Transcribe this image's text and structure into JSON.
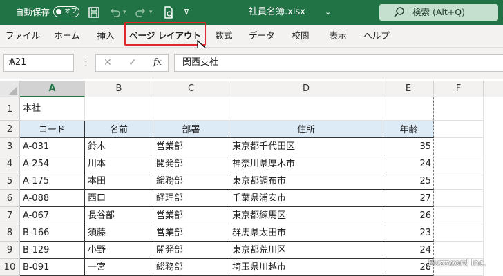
{
  "titlebar": {
    "autosave_label": "自動保存",
    "autosave_state": "オフ",
    "doc_title": "社員名簿.xlsx",
    "title_chevron": "⌄",
    "search_text": "検索 (Alt+Q)",
    "color": "#217346"
  },
  "ribbon": {
    "tabs": [
      "ファイル",
      "ホーム",
      "挿入",
      "ページ レイアウト",
      "数式",
      "データ",
      "校閲",
      "表示",
      "ヘルプ"
    ],
    "active_tab": "ページ レイアウト",
    "highlight_color": "#e0262b"
  },
  "formula_bar": {
    "name_box": "A21",
    "dots": "⋮",
    "cancel": "✕",
    "enter": "✓",
    "fx": "fx",
    "content": "関西支社"
  },
  "grid": {
    "columns": [
      "A",
      "B",
      "C",
      "D",
      "E",
      "F"
    ],
    "selected_column": "A",
    "rows": [
      "1",
      "2",
      "3",
      "4",
      "5",
      "6",
      "7",
      "8",
      "9",
      "10"
    ],
    "title_cell": "本社",
    "table_header": [
      "コード",
      "名前",
      "部署",
      "住所",
      "年齢"
    ],
    "table_rows": [
      [
        "A-031",
        "鈴木",
        "営業部",
        "東京都千代田区",
        "35"
      ],
      [
        "A-254",
        "川本",
        "開発部",
        "神奈川県厚木市",
        "24"
      ],
      [
        "A-175",
        "本田",
        "総務部",
        "東京都調布市",
        "25"
      ],
      [
        "A-088",
        "西口",
        "経理部",
        "千葉県浦安市",
        "27"
      ],
      [
        "A-067",
        "長谷部",
        "営業部",
        "東京都練馬区",
        "26"
      ],
      [
        "B-166",
        "須藤",
        "営業部",
        "群馬県太田市",
        "23"
      ],
      [
        "B-129",
        "小野",
        "開発部",
        "東京都荒川区",
        "24"
      ],
      [
        "B-091",
        "一宮",
        "総務部",
        "埼玉県川越市",
        "28"
      ]
    ],
    "header_fill": "#ddebf7"
  },
  "watermark": "Buzzword Inc."
}
